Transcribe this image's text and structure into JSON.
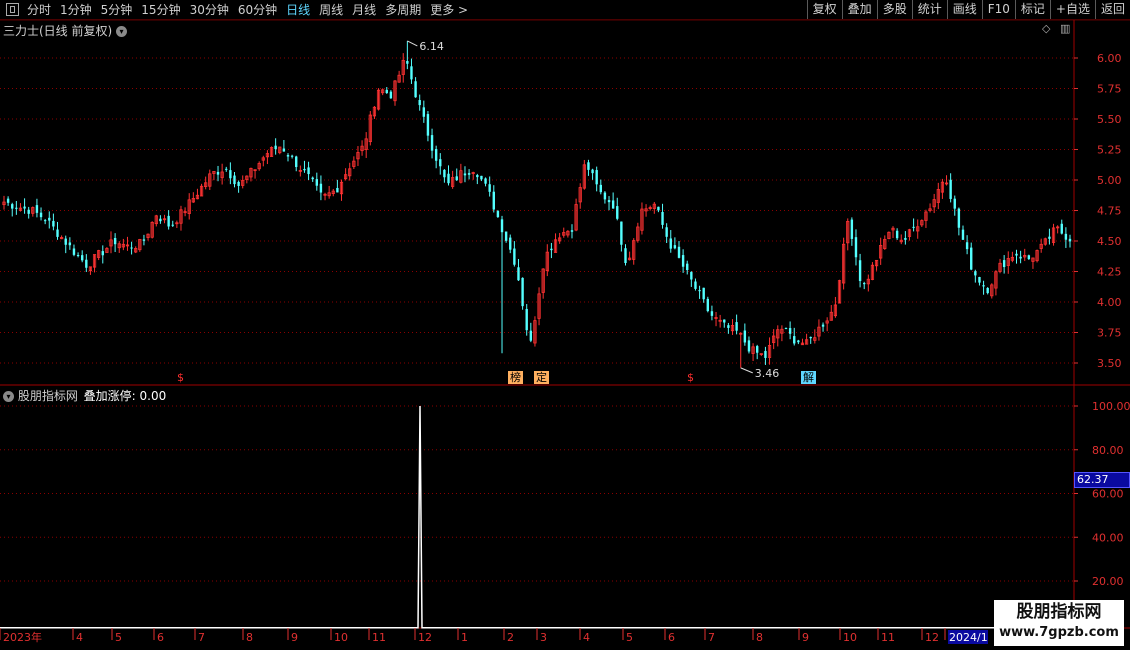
{
  "toolbar": {
    "periods": [
      "分时",
      "1分钟",
      "5分钟",
      "15分钟",
      "30分钟",
      "60分钟",
      "日线",
      "周线",
      "月线",
      "多周期",
      "更多 >"
    ],
    "active_period": "日线",
    "buttons": [
      "复权",
      "叠加",
      "多股",
      "统计",
      "画线",
      "F10",
      "标记",
      "+自选",
      "返回"
    ]
  },
  "main_panel": {
    "title": "三力士(日线 前复权)",
    "high_label": "6.14",
    "low_label": "3.46",
    "markers": [
      {
        "text": "$",
        "color": "#ff3030",
        "bg": "none"
      },
      {
        "text": "榜",
        "color": "#000",
        "bg": "#ffb060"
      },
      {
        "text": "定",
        "color": "#000",
        "bg": "#ffb060"
      },
      {
        "text": "$",
        "color": "#ff3030",
        "bg": "none"
      },
      {
        "text": "解",
        "color": "#000",
        "bg": "#5fd7ff"
      }
    ]
  },
  "indicator_panel": {
    "title": "股朋指标网",
    "series_label": "叠加涨停: 0.00",
    "current_value_label": "62.37"
  },
  "x_axis": {
    "labels": [
      "2023年",
      "4",
      "5",
      "6",
      "7",
      "8",
      "9",
      "10",
      "11",
      "12",
      "1",
      "2",
      "3",
      "4",
      "5",
      "6",
      "7",
      "8",
      "9",
      "10",
      "11",
      "12",
      "2024/1"
    ]
  },
  "watermark": {
    "line1": "股朋指标网",
    "line2": "www.7gpzb.com"
  },
  "colors": {
    "up": "#ff3232",
    "down": "#54ffff",
    "grid": "#8b0000",
    "axis": "#e03030"
  },
  "chart_data": [
    {
      "type": "candlestick",
      "title": "三力士(日线 前复权)",
      "ylim": [
        3.4,
        6.2
      ],
      "y_ticks": [
        3.5,
        3.75,
        4.0,
        4.25,
        4.5,
        4.75,
        5.0,
        5.25,
        5.5,
        5.75,
        6.0
      ],
      "high": 6.14,
      "low": 3.46,
      "x_labels": [
        "2023年",
        "4",
        "5",
        "6",
        "7",
        "8",
        "9",
        "10",
        "11",
        "12",
        "1",
        "2",
        "3",
        "4",
        "5",
        "6",
        "7",
        "8",
        "9",
        "10",
        "11",
        "12",
        "2024/1"
      ],
      "close_path": [
        4.82,
        4.78,
        4.75,
        4.68,
        4.55,
        4.42,
        4.3,
        4.4,
        4.5,
        4.45,
        4.48,
        4.72,
        4.62,
        4.75,
        4.9,
        5.05,
        5.1,
        4.95,
        5.08,
        5.22,
        5.28,
        5.15,
        5.02,
        4.85,
        4.92,
        5.12,
        5.28,
        5.75,
        5.7,
        6.0,
        5.6,
        5.25,
        4.95,
        5.05,
        5.1,
        4.9,
        4.6,
        4.3,
        3.62,
        4.35,
        4.55,
        4.6,
        5.15,
        4.9,
        4.8,
        4.3,
        4.75,
        4.8,
        4.5,
        4.3,
        4.1,
        3.9,
        3.8,
        3.75,
        3.6,
        3.55,
        3.8,
        3.7,
        3.65,
        3.8,
        3.95,
        4.7,
        4.1,
        4.35,
        4.6,
        4.5,
        4.65,
        4.8,
        5.05,
        4.6,
        4.25,
        4.1,
        4.3,
        4.4,
        4.35,
        4.45,
        4.6,
        4.52
      ]
    },
    {
      "type": "line",
      "series": [
        {
          "name": "叠加涨停",
          "values": [
            0,
            0,
            100,
            0,
            0
          ]
        }
      ],
      "ylim": [
        0,
        110
      ],
      "y_ticks": [
        20.0,
        40.0,
        60.0,
        80.0,
        100.0
      ],
      "spike_value": 100,
      "current_value": 0.0
    }
  ]
}
